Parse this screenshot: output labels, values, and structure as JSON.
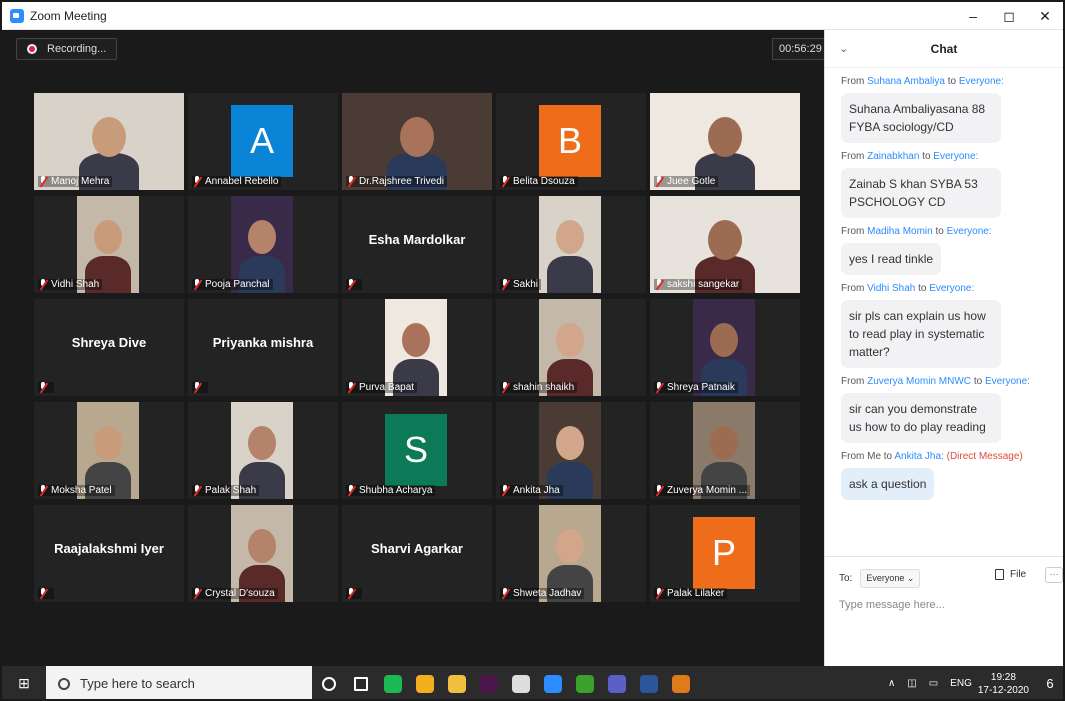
{
  "window": {
    "title": "Zoom Meeting",
    "controls": [
      "–",
      "◻",
      "✕"
    ]
  },
  "meeting": {
    "recording_label": "Recording...",
    "timer": "00:56:29"
  },
  "participants": [
    {
      "name": "Manoj Mehra",
      "kind": "photo",
      "active": true
    },
    {
      "name": "Annabel Rebello",
      "kind": "avatar",
      "letter": "A",
      "color": "#0a84d6"
    },
    {
      "name": "Dr.Rajshree Trivedi",
      "kind": "photo"
    },
    {
      "name": "Belita Dsouza",
      "kind": "avatar",
      "letter": "B",
      "color": "#ef6d1a"
    },
    {
      "name": "Juee Gotle",
      "kind": "photo"
    },
    {
      "name": "Vidhi Shah",
      "kind": "photo"
    },
    {
      "name": "Pooja Panchal",
      "kind": "photo"
    },
    {
      "name": "Esha Mardolkar",
      "kind": "name"
    },
    {
      "name": "Sakhi",
      "kind": "photo"
    },
    {
      "name": "sakshi sangekar",
      "kind": "photo"
    },
    {
      "name": "Shreya Dive",
      "kind": "name"
    },
    {
      "name": "Priyanka mishra",
      "kind": "name"
    },
    {
      "name": "Purva Bapat",
      "kind": "photo"
    },
    {
      "name": "shahin shaikh",
      "kind": "photo"
    },
    {
      "name": "Shreya Patnaik",
      "kind": "photo"
    },
    {
      "name": "Moksha Patel",
      "kind": "photo"
    },
    {
      "name": "Palak Shah",
      "kind": "photo"
    },
    {
      "name": "Shubha Acharya",
      "kind": "avatar",
      "letter": "S",
      "color": "#0c7a57"
    },
    {
      "name": "Ankita Jha",
      "kind": "photo"
    },
    {
      "name": "Zuverya Momin ...",
      "kind": "photo"
    },
    {
      "name": "Raajalakshmi Iyer",
      "kind": "name"
    },
    {
      "name": "Crystal D'souza",
      "kind": "photo"
    },
    {
      "name": "Sharvi Agarkar",
      "kind": "name"
    },
    {
      "name": "Shweta Jadhav",
      "kind": "photo"
    },
    {
      "name": "Palak Lilaker",
      "kind": "avatar",
      "letter": "P",
      "color": "#ef6d1a"
    }
  ],
  "chat": {
    "title": "Chat",
    "messages": [
      {
        "from_prefix": "From",
        "sender": "Suhana Ambaliya",
        "to_word": "to",
        "recipient": "Everyone:",
        "text": "Suhana Ambaliyasana 88 FYBA sociology/CD"
      },
      {
        "from_prefix": "From",
        "sender": "Zainabkhan",
        "to_word": "to",
        "recipient": "Everyone:",
        "text": "Zainab S khan SYBA 53 PSCHOLOGY CD"
      },
      {
        "from_prefix": "From",
        "sender": "Madiha Momin",
        "to_word": "to",
        "recipient": "Everyone:",
        "text": "yes I read tinkle"
      },
      {
        "from_prefix": "From",
        "sender": "Vidhi Shah",
        "to_word": "to",
        "recipient": "Everyone:",
        "text": "sir pls can explain us how to read play in systematic matter?"
      },
      {
        "from_prefix": "From",
        "sender": "Zuverya Momin MNWC",
        "to_word": "to",
        "recipient": "Everyone:",
        "text": "sir can you demonstrate us how to do play reading"
      },
      {
        "from_prefix": "From Me",
        "sender": "",
        "to_word": "to",
        "recipient": "Ankita Jha:",
        "dm": "(Direct Message)",
        "text": "ask a question",
        "me": true
      }
    ],
    "to_label": "To:",
    "to_value": "Everyone ⌄",
    "file_label": "File",
    "more_label": "···",
    "input_placeholder": "Type message here..."
  },
  "taskbar": {
    "search_placeholder": "Type here to search",
    "apps": [
      {
        "name": "cortana",
        "color": "#2b2b2b"
      },
      {
        "name": "task-view",
        "color": "#2b2b2b"
      },
      {
        "name": "spotify",
        "color": "#1db954"
      },
      {
        "name": "chrome",
        "color": "#f2b01e"
      },
      {
        "name": "file-explorer",
        "color": "#f0c040"
      },
      {
        "name": "slack",
        "color": "#4a154b"
      },
      {
        "name": "browser",
        "color": "#ddd"
      },
      {
        "name": "zoom",
        "color": "#2d8cff"
      },
      {
        "name": "app-green",
        "color": "#3ca02c"
      },
      {
        "name": "teams",
        "color": "#5b5fc7"
      },
      {
        "name": "word",
        "color": "#2b579a"
      },
      {
        "name": "waves",
        "color": "#e07b1a"
      }
    ],
    "lang": "ENG",
    "time": "19:28",
    "date": "17-12-2020",
    "notif_count": "6"
  },
  "colors": {
    "video_bg": "#1a1a1a",
    "tile_bg": "#232323",
    "active_border": "#c6e06a",
    "accent": "#2d8cff"
  }
}
